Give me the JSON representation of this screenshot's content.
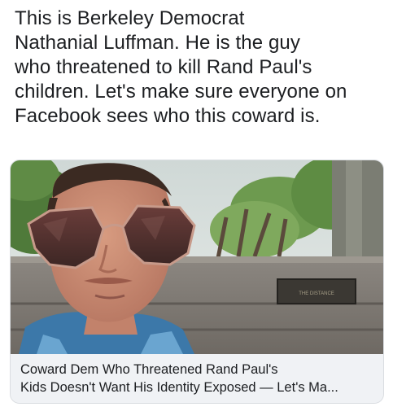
{
  "post": {
    "text_lines": [
      "This is Berkeley Democrat",
      "Nathanial Luffman. He is the guy",
      "who threatened to kill Rand Paul's",
      "children. Let's make sure everyone on",
      "Facebook sees who this coward is."
    ]
  },
  "link_card": {
    "title_lines": [
      "Coward Dem Who Threatened Rand Paul's",
      "Kids Doesn't Want His Identity Exposed — Let's Ma..."
    ],
    "image": {
      "icons": [
        "man-photo",
        "sunglasses-icon",
        "tree-icon",
        "bench-plaque-icon"
      ],
      "plaque_text": "THE DISTANCE"
    }
  },
  "colors": {
    "text": "#1c1e21",
    "card_background": "#f0f2f5",
    "card_border": "#dadde1"
  }
}
